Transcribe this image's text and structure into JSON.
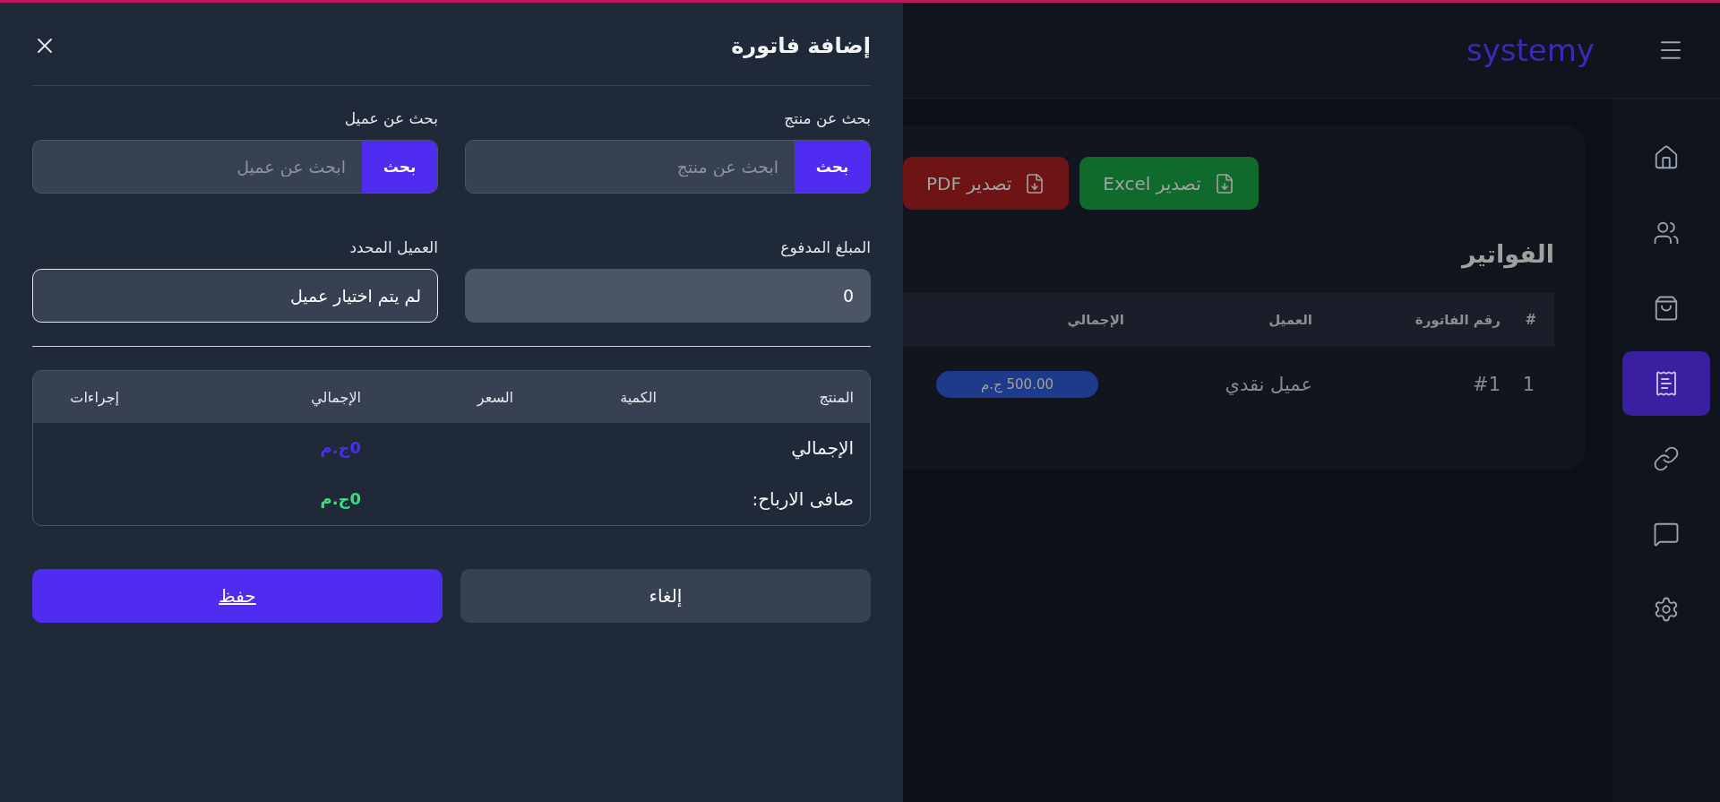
{
  "drawer": {
    "title": "إضافة فاتورة",
    "search_fields": [
      {
        "label": "بحث عن منتج",
        "placeholder": "ابحث عن منتج",
        "button": "بحث"
      },
      {
        "label": "بحث عن عميل",
        "placeholder": "ابحث عن عميل",
        "button": "بحث"
      }
    ],
    "paid_amount": {
      "label": "المبلغ المدفوع",
      "value": "0"
    },
    "selected_client": {
      "label": "العميل المحدد",
      "value": "لم يتم اختيار عميل"
    },
    "items_table": {
      "columns": [
        "المنتج",
        "الكمية",
        "السعر",
        "الإجمالي",
        "إجراءات"
      ],
      "summary": [
        {
          "label": "الإجمالي",
          "value": "0ج.م",
          "color": "#4f2cf0"
        },
        {
          "label": "صافى الارباح:",
          "value": "0ج.م",
          "color": "#3ddc84"
        }
      ]
    },
    "buttons": [
      {
        "label": "إلغاء",
        "kind": "secondary"
      },
      {
        "label": "حفظ",
        "kind": "primary"
      }
    ]
  },
  "header": {
    "logo": "systemy"
  },
  "sidebar": {
    "items": [
      {
        "kind": "home",
        "selected": false
      },
      {
        "kind": "users",
        "selected": false
      },
      {
        "kind": "bag",
        "selected": false
      },
      {
        "kind": "receipt",
        "selected": true
      },
      {
        "kind": "link",
        "selected": false
      },
      {
        "kind": "chat",
        "selected": false
      },
      {
        "kind": "settings",
        "selected": false
      }
    ]
  },
  "invoices": {
    "title": "الفواتير",
    "exports": [
      {
        "label": "تصدير Excel",
        "kind": "excel"
      },
      {
        "label": "تصدير PDF",
        "kind": "pdf"
      }
    ],
    "columns": [
      "#",
      "رقم الفاتورة",
      "العميل",
      "الإجمالي"
    ],
    "rows": [
      {
        "index": "1",
        "number": "#1",
        "client": "عميل نقدي",
        "total": "500.00 ج.م"
      }
    ]
  }
}
